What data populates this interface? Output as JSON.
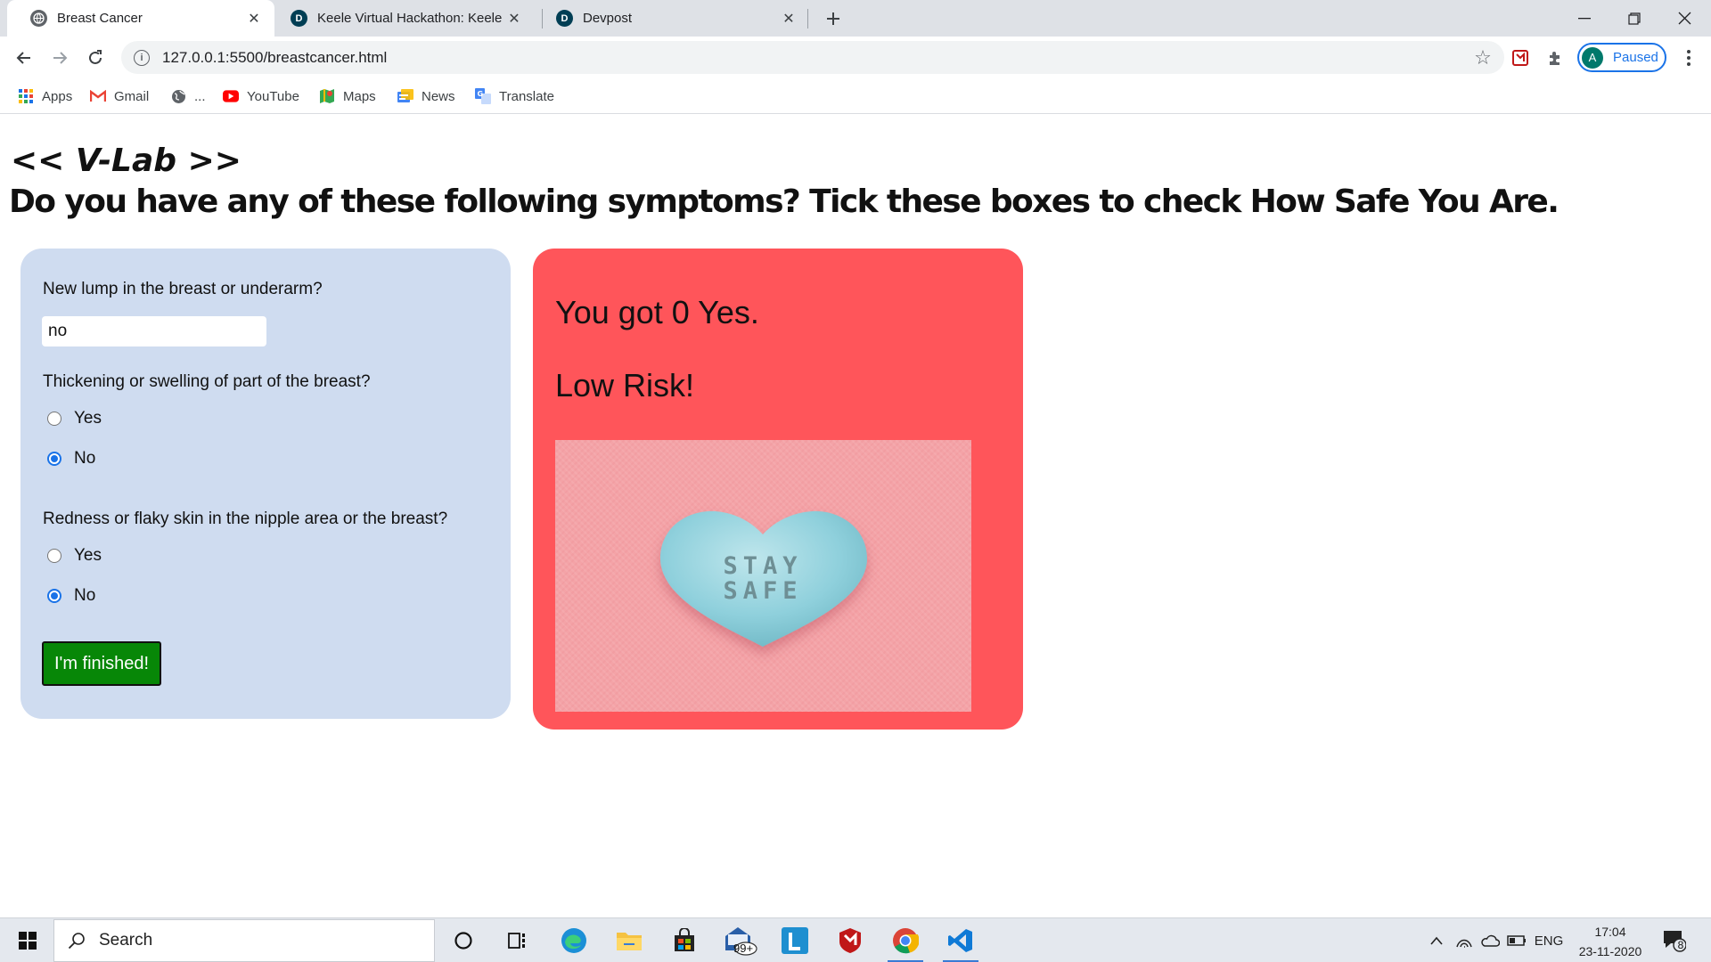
{
  "browser": {
    "tabs": [
      {
        "title": "Breast Cancer",
        "icon": "globe-icon",
        "active": true
      },
      {
        "title": "Keele Virtual Hackathon: Keele H",
        "icon": "devpost-icon",
        "active": false
      },
      {
        "title": "Devpost",
        "icon": "devpost-icon",
        "active": false
      }
    ],
    "url": "127.0.0.1:5500/breastcancer.html",
    "profile_initial": "A",
    "profile_status": "Paused",
    "bookmarks": [
      {
        "label": "Apps",
        "icon": "apps-grid-icon"
      },
      {
        "label": "Gmail",
        "icon": "gmail-icon"
      },
      {
        "label": "...",
        "icon": "globe-icon"
      },
      {
        "label": "YouTube",
        "icon": "youtube-icon"
      },
      {
        "label": "Maps",
        "icon": "maps-icon"
      },
      {
        "label": "News",
        "icon": "news-icon"
      },
      {
        "label": "Translate",
        "icon": "translate-icon"
      }
    ]
  },
  "page": {
    "logo": "<< V-Lab >>",
    "heading": "Do you have any of these following symptoms? Tick these boxes to check How Safe You Are."
  },
  "quiz": {
    "q1": {
      "label": "New lump in the breast or underarm?",
      "value": "no"
    },
    "q2": {
      "label": "Thickening or swelling of part of the breast?",
      "options": [
        {
          "label": "Yes",
          "checked": false
        },
        {
          "label": "No",
          "checked": true
        }
      ]
    },
    "q3": {
      "label": "Redness or flaky skin in the nipple area or the breast?",
      "options": [
        {
          "label": "Yes",
          "checked": false
        },
        {
          "label": "No",
          "checked": true
        }
      ]
    },
    "finish_label": "I'm finished!"
  },
  "result": {
    "count_text": "You got 0 Yes.",
    "risk_text": "Low Risk!",
    "image_caption_line1": "STAY",
    "image_caption_line2": "SAFE"
  },
  "taskbar": {
    "search_placeholder": "Search",
    "mail_badge": "99+",
    "language": "ENG",
    "time": "17:04",
    "date": "23-11-2020",
    "notification_count": "8"
  },
  "colors": {
    "quiz_panel_bg": "#cfdcf0",
    "result_panel_bg": "#ff555a",
    "finish_button_bg": "#078707",
    "accent_blue": "#1a73e8"
  }
}
